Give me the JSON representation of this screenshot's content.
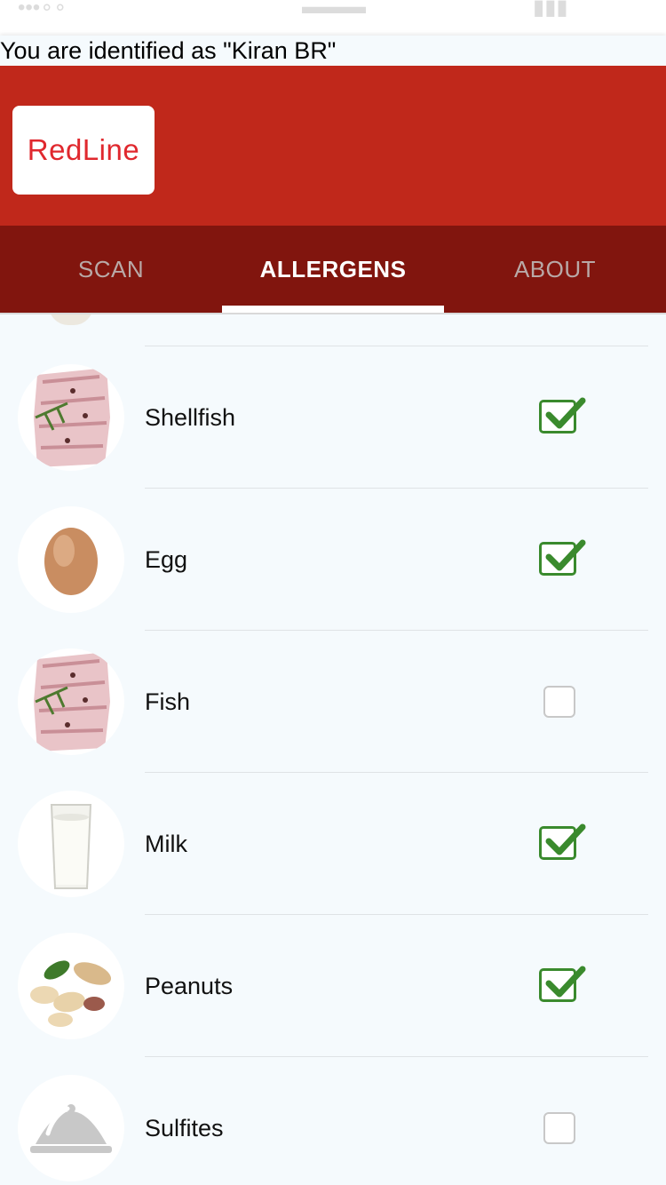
{
  "identity_text": "You are identified as \"Kiran BR\"",
  "logo_text": "RedLine",
  "tabs": [
    {
      "label": "SCAN",
      "active": false
    },
    {
      "label": "ALLERGENS",
      "active": true
    },
    {
      "label": "ABOUT",
      "active": false
    }
  ],
  "allergens": [
    {
      "name": "Shellfish",
      "icon": "fish-fillet-icon",
      "checked": true
    },
    {
      "name": "Egg",
      "icon": "egg-icon",
      "checked": true
    },
    {
      "name": "Fish",
      "icon": "fish-fillet-icon",
      "checked": false
    },
    {
      "name": "Milk",
      "icon": "milk-glass-icon",
      "checked": true
    },
    {
      "name": "Peanuts",
      "icon": "peanuts-icon",
      "checked": true
    },
    {
      "name": "Sulfites",
      "icon": "food-cloche-icon",
      "checked": false
    }
  ],
  "colors": {
    "header_red": "#c0281b",
    "tab_bar": "#81150e",
    "check_green": "#3a8a2d"
  }
}
